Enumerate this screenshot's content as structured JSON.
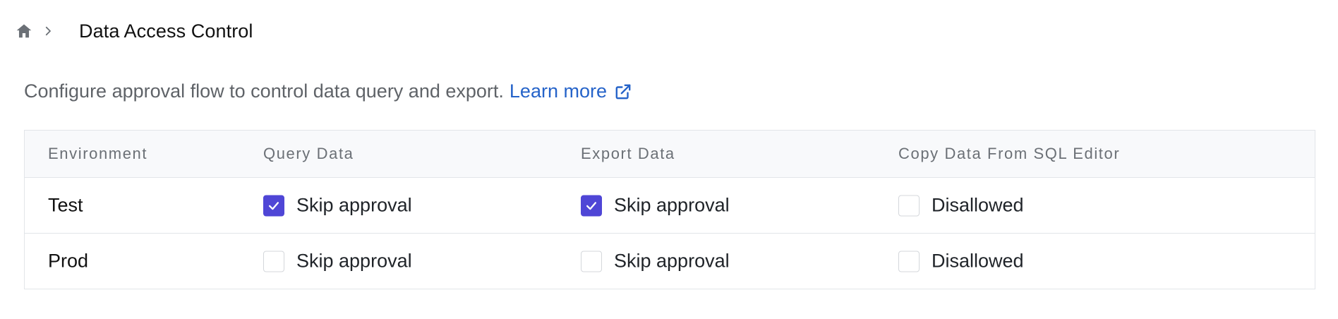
{
  "breadcrumb": {
    "home_icon": "home-icon",
    "separator_icon": "chevron-right-icon",
    "title": "Data Access Control"
  },
  "description": {
    "text": "Configure approval flow to control data query and export.",
    "link_label": "Learn more",
    "link_icon": "external-link-icon"
  },
  "table": {
    "headers": [
      "Environment",
      "Query Data",
      "Export Data",
      "Copy Data From SQL Editor"
    ],
    "rows": [
      {
        "environment": "Test",
        "query": {
          "label": "Skip approval",
          "checked": true
        },
        "export": {
          "label": "Skip approval",
          "checked": true
        },
        "copy": {
          "label": "Disallowed",
          "checked": false
        }
      },
      {
        "environment": "Prod",
        "query": {
          "label": "Skip approval",
          "checked": false
        },
        "export": {
          "label": "Skip approval",
          "checked": false
        },
        "copy": {
          "label": "Disallowed",
          "checked": false
        }
      }
    ]
  },
  "colors": {
    "accent": "#4f46d6",
    "link": "#2563c9",
    "border": "#e2e5e9",
    "header_bg": "#f8f9fb"
  }
}
